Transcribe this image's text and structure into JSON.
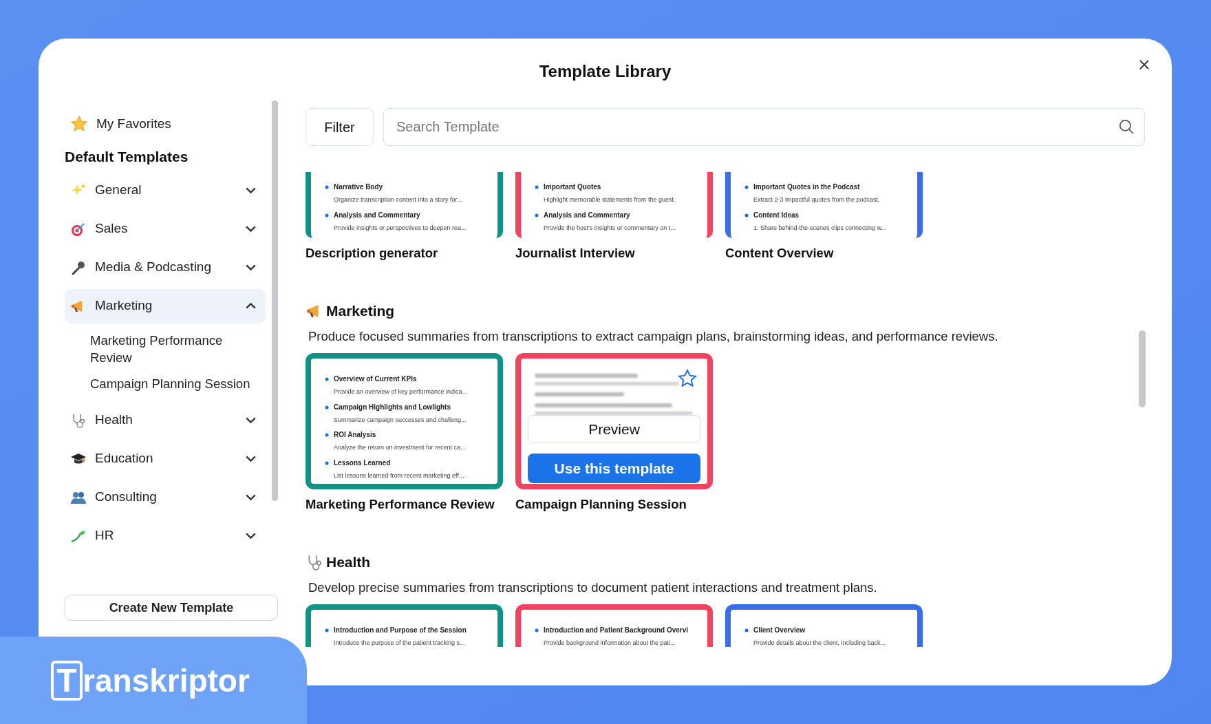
{
  "title": "Template Library",
  "filter_button": "Filter",
  "search": {
    "placeholder": "Search Template"
  },
  "sidebar": {
    "favorites": "My Favorites",
    "heading": "Default Templates",
    "categories": [
      {
        "label": "General",
        "expanded": false
      },
      {
        "label": "Sales",
        "expanded": false
      },
      {
        "label": "Media & Podcasting",
        "expanded": false
      },
      {
        "label": "Marketing",
        "expanded": true,
        "children": [
          "Marketing Performance Review",
          "Campaign Planning Session"
        ]
      },
      {
        "label": "Health",
        "expanded": false
      },
      {
        "label": "Education",
        "expanded": false
      },
      {
        "label": "Consulting",
        "expanded": false
      },
      {
        "label": "HR",
        "expanded": false
      }
    ],
    "create_button": "Create New Template"
  },
  "sections": [
    {
      "cards": [
        {
          "name": "Description generator",
          "color": "#109384",
          "items": [
            {
              "heading": "Narrative Body",
              "text": "Organize transcription content into a story for..."
            },
            {
              "heading": "Analysis and Commentary",
              "text": "Provide insights or perspectives to deepen rea..."
            }
          ]
        },
        {
          "name": "Journalist Interview",
          "color": "#f4425f",
          "items": [
            {
              "heading": "Important Quotes",
              "text": "Highlight memorable statements from the guest."
            },
            {
              "heading": "Analysis and Commentary",
              "text": "Provide the host's insights or commentary on t..."
            }
          ]
        },
        {
          "name": "Content Overview",
          "color": "#3a6ee8",
          "items": [
            {
              "heading": "Important Quotes in the Podcast",
              "text": "Extract 2-3 impactful quotes from the podcast."
            },
            {
              "heading": "Content Ideas",
              "text": "1. Share behind-the-scenes clips connecting w..."
            }
          ]
        }
      ]
    },
    {
      "title": "Marketing",
      "description": "Produce focused summaries from transcriptions to extract campaign plans, brainstorming ideas, and performance reviews.",
      "cards": [
        {
          "name": "Marketing Performance Review",
          "color": "#109384",
          "items": [
            {
              "heading": "Overview of Current KPIs",
              "text": "Provide an overview of key performance indica..."
            },
            {
              "heading": "Campaign Highlights and Lowlights",
              "text": "Summarize campaign successes and challeng..."
            },
            {
              "heading": "ROI Analysis",
              "text": "Analyze the return on investment for recent ca..."
            },
            {
              "heading": "Lessons Learned",
              "text": "List lessons learned from recent marketing eff..."
            }
          ]
        },
        {
          "name": "Campaign Planning Session",
          "color": "#f4425f",
          "hovered": true,
          "favorite": false,
          "preview_button": "Preview",
          "use_button": "Use this template"
        }
      ]
    },
    {
      "title": "Health",
      "description": "Develop precise summaries from transcriptions to document patient interactions and treatment plans.",
      "cards": [
        {
          "color": "#109384",
          "items": [
            {
              "heading": "Introduction and Purpose of the Session",
              "text": "Introduce the purpose of the patient tracking s..."
            }
          ]
        },
        {
          "color": "#f4425f",
          "items": [
            {
              "heading": "Introduction and Patient Background Overvi",
              "text": "Provide background information about the pati..."
            }
          ]
        },
        {
          "color": "#3a6ee8",
          "items": [
            {
              "heading": "Client Overview",
              "text": "Provide details about the client, including back..."
            }
          ]
        }
      ]
    }
  ],
  "brand": {
    "initial": "T",
    "rest": "ranskriptor"
  }
}
